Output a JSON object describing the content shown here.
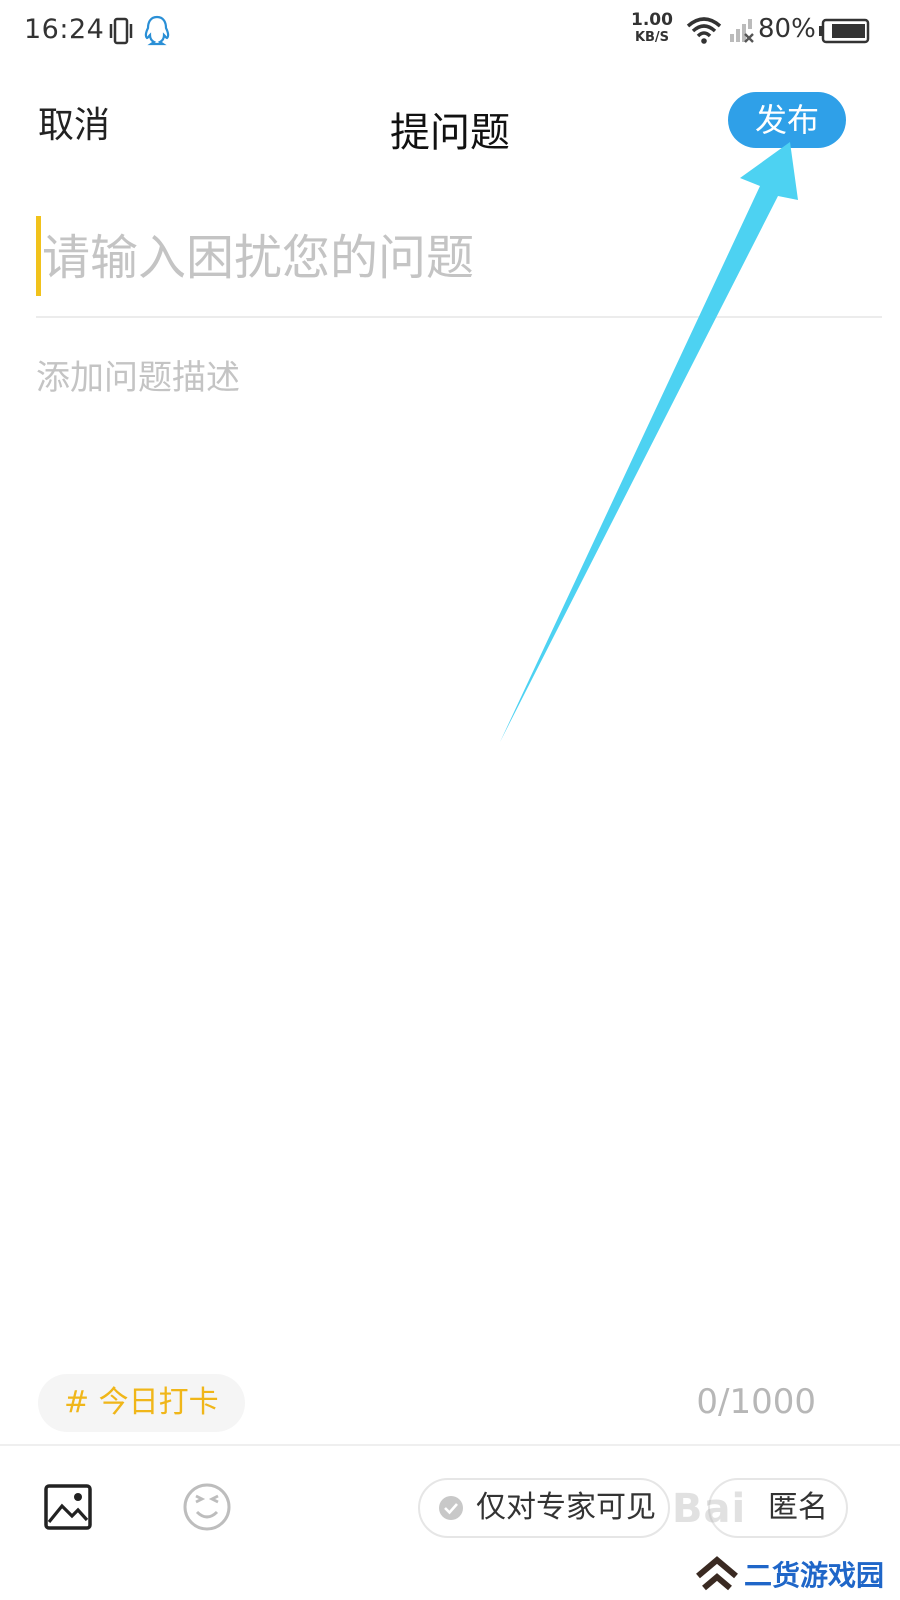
{
  "status_bar": {
    "time": "16:24",
    "net_speed_value": "1.00",
    "net_speed_unit": "KB/S",
    "battery_percent": "80%",
    "icons": [
      "vibrate-icon",
      "qq-icon",
      "wifi-icon",
      "signal-icon",
      "battery-icon"
    ]
  },
  "nav": {
    "cancel_label": "取消",
    "title": "提问题",
    "publish_label": "发布"
  },
  "question": {
    "title_placeholder": "请输入困扰您的问题",
    "title_value": "",
    "description_placeholder": "添加问题描述",
    "description_value": ""
  },
  "bottom": {
    "tag_label": "# 今日打卡",
    "char_counter": "0/1000",
    "expert_only_label": "仅对专家可见",
    "anonymous_label": "匿名",
    "icons": [
      "image-icon",
      "emoji-icon",
      "check-circle-icon"
    ]
  },
  "watermarks": {
    "baidu": "Bai",
    "site": "二货游戏园"
  },
  "colors": {
    "accent_blue": "#2fa0e8",
    "caret_yellow": "#f1c21b",
    "tag_yellow": "#f0b619",
    "annotation_arrow": "#4dd2f2"
  }
}
